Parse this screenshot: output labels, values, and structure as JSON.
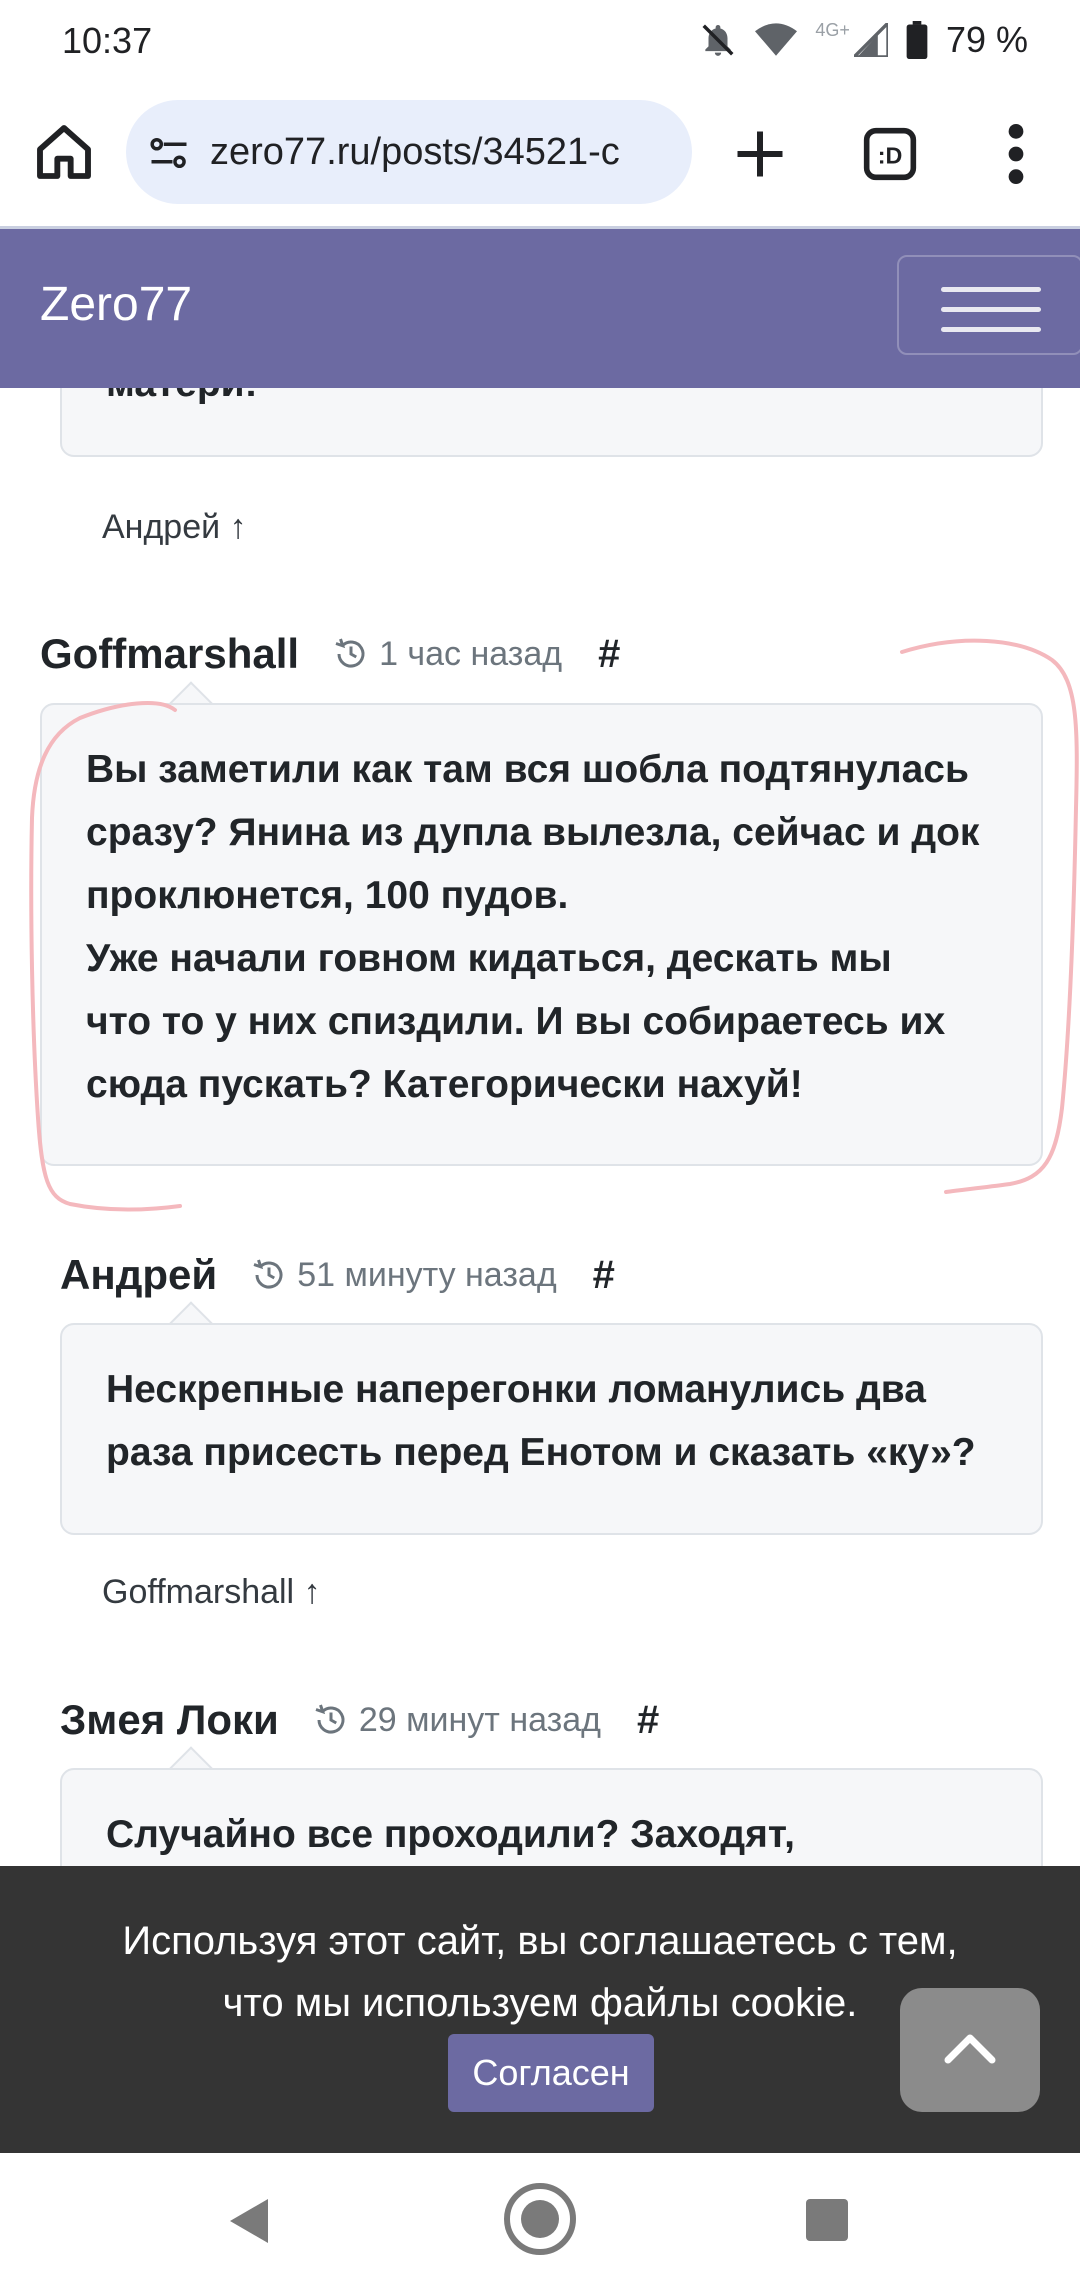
{
  "status_bar": {
    "time": "10:37",
    "network": "4G+",
    "battery": "79 %"
  },
  "browser": {
    "url": "zero77.ru/posts/34521-c"
  },
  "site": {
    "brand": "Zero77"
  },
  "comments": {
    "previous_tail": {
      "text": "матери!",
      "reply_to": "Андрей ↑"
    },
    "c1": {
      "author": "Goffmarshall",
      "time": "1 час назад",
      "permalink": "#",
      "lines": [
        "Вы заметили как там вся шобла подтянулась",
        "сразу? Янина из дупла вылезла, сейчас и док",
        "проклюнется, 100 пудов.",
        "Уже начали говном кидаться, дескать мы",
        "что то у них спиздили. И вы собираетесь их",
        "сюда пускать? Категорически нахуй!"
      ]
    },
    "c2": {
      "author": "Андрей",
      "time": "51 минуту назад",
      "permalink": "#",
      "lines": [
        "Нескрепные наперегонки ломанулись два",
        "раза присесть перед Енотом и сказать «ку»?"
      ],
      "reply_to": "Goffmarshall ↑"
    },
    "c3": {
      "author": "Змея Локи",
      "time": "29 минут назад",
      "permalink": "#",
      "lines": [
        "Случайно все проходили? Заходят,"
      ]
    }
  },
  "cookie_banner": {
    "line1": "Используя этот сайт, вы соглашаетесь с тем,",
    "line2": "что мы используем файлы cookie.",
    "button": "Согласен"
  },
  "annotation_color": "#f4b8bd",
  "accent_color": "#6c6aa2"
}
